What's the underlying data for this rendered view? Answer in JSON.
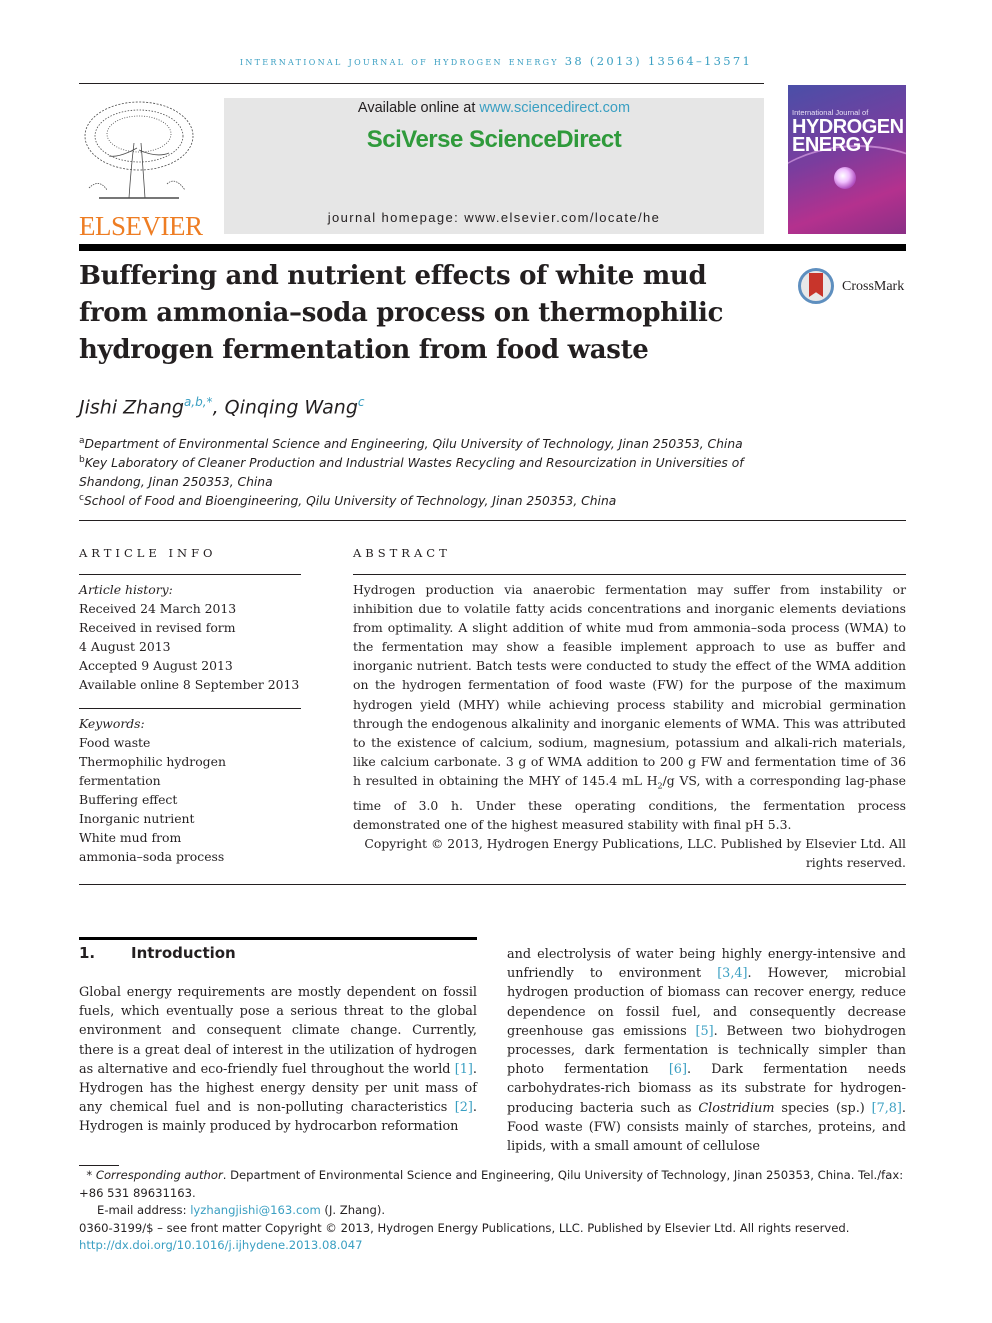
{
  "running_head": "International Journal of Hydrogen Energy 38 (2013) 13564–13571",
  "header": {
    "publisher_logo": "tree-icon",
    "publisher_name": "ELSEVIER",
    "available_prefix": "Available online at ",
    "available_link": "www.sciencedirect.com",
    "platform_name": "SciVerse ScienceDirect",
    "homepage": "journal homepage: www.elsevier.com/locate/he",
    "cover": {
      "small_line": "International Journal of",
      "title_line1": "HYDROGEN",
      "title_line2": "ENERGY"
    }
  },
  "article": {
    "title": "Buffering and nutrient effects of white mud from ammonia–soda process on thermophilic hydrogen fermentation from food waste",
    "crossmark_label": "CrossMark",
    "authors": [
      {
        "name": "Jishi Zhang",
        "sup": "a,b,*"
      },
      {
        "name": "Qinqing Wang",
        "sup": "c"
      }
    ],
    "author_separator": ", ",
    "affiliations": [
      {
        "sup": "a",
        "text": "Department of Environmental Science and Engineering, Qilu University of Technology, Jinan 250353, China"
      },
      {
        "sup": "b",
        "text": "Key Laboratory of Cleaner Production and Industrial Wastes Recycling and Resourcization in Universities of",
        "text2": "Shandong, Jinan 250353, China"
      },
      {
        "sup": "c",
        "text": "School of Food and Bioengineering, Qilu University of Technology, Jinan 250353, China"
      }
    ]
  },
  "article_info": {
    "heading": "ARTICLE INFO",
    "history_label": "Article history:",
    "history": [
      "Received 24 March 2013",
      "Received in revised form",
      "4 August 2013",
      "Accepted 9 August 2013",
      "Available online 8 September 2013"
    ],
    "keywords_label": "Keywords:",
    "keywords": [
      "Food waste",
      "Thermophilic hydrogen",
      "fermentation",
      "Buffering effect",
      "Inorganic nutrient",
      "White mud from",
      "ammonia–soda process"
    ]
  },
  "abstract": {
    "heading": "ABSTRACT",
    "text_part1": "Hydrogen production via anaerobic fermentation may suffer from instability or inhibition due to volatile fatty acids concentrations and inorganic elements deviations from optimality. A slight addition of white mud from ammonia–soda process (WMA) to the fermentation may show a feasible implement approach to use as buffer and inorganic nutrient. Batch tests were conducted to study the effect of the WMA addition on the hydrogen fermentation of food waste (FW) for the purpose of the maximum hydrogen yield (MHY) while achieving process stability and microbial germination through the endogenous alkalinity and inorganic elements of WMA. This was attributed to the existence of calcium, sodium, magnesium, potassium and alkali-rich materials, like calcium carbonate. 3 g of WMA addition to 200 g FW and fermentation time of 36 h resulted in obtaining the MHY of 145.4 mL H",
    "subscript": "2",
    "text_part2": "/g VS, with a corresponding lag-phase time of 3.0 h. Under these operating conditions, the fermentation process demonstrated one of the highest measured stability with final pH 5.3.",
    "copyright": "Copyright © 2013, Hydrogen Energy Publications, LLC. Published by Elsevier Ltd. All rights reserved."
  },
  "introduction": {
    "number": "1.",
    "heading": "Introduction",
    "left_col": [
      {
        "t": "Global energy requirements are mostly dependent on fossil fuels, which eventually pose a serious threat to the global environment and consequent climate change. Currently, there is a great deal of interest in the utilization of hydrogen as alternative and eco-friendly fuel throughout the world "
      },
      {
        "ref": "[1]"
      },
      {
        "t": ". Hydrogen has the highest energy density per unit mass of any chemical fuel and is non-polluting characteristics "
      },
      {
        "ref": "[2]"
      },
      {
        "t": ". Hydrogen is mainly produced by hydrocarbon reformation"
      }
    ],
    "right_col": [
      {
        "t": "and electrolysis of water being highly energy-intensive and unfriendly to environment "
      },
      {
        "ref": "[3,4]"
      },
      {
        "t": ". However, microbial hydrogen production of biomass can recover energy, reduce dependence on fossil fuel, and consequently decrease greenhouse gas emissions "
      },
      {
        "ref": "[5]"
      },
      {
        "t": ". Between two biohydrogen processes, dark fermentation is technically simpler than photo fermentation "
      },
      {
        "ref": "[6]"
      },
      {
        "t": ". Dark fermentation needs carbohydrates-rich biomass as its substrate for hydrogen-producing bacteria such as "
      },
      {
        "it": "Clostridium"
      },
      {
        "t": " species (sp.) "
      },
      {
        "ref": "[7,8]"
      },
      {
        "t": ". Food waste (FW) consists mainly of starches, proteins, and lipids, with a small amount of cellulose"
      }
    ]
  },
  "footnotes": {
    "corresponding_mark": "*",
    "corresponding_label": "Corresponding author",
    "corresponding_text": ". Department of Environmental Science and Engineering, Qilu University of Technology, Jinan 250353, China. Tel./fax: +86 531 89631163.",
    "email_label": "E-mail address: ",
    "email": "lyzhangjishi@163.com",
    "email_suffix": " (J. Zhang).",
    "issn_line": "0360-3199/$ – see front matter Copyright © 2013, Hydrogen Energy Publications, LLC. Published by Elsevier Ltd. All rights reserved.",
    "doi": "http://dx.doi.org/10.1016/j.ijhydene.2013.08.047"
  },
  "colors": {
    "link": "#3a9fc2",
    "brand_orange": "#ee7d23",
    "sciencedirect_green": "#2f9a3b",
    "banner_bg": "#e6e6e6"
  }
}
